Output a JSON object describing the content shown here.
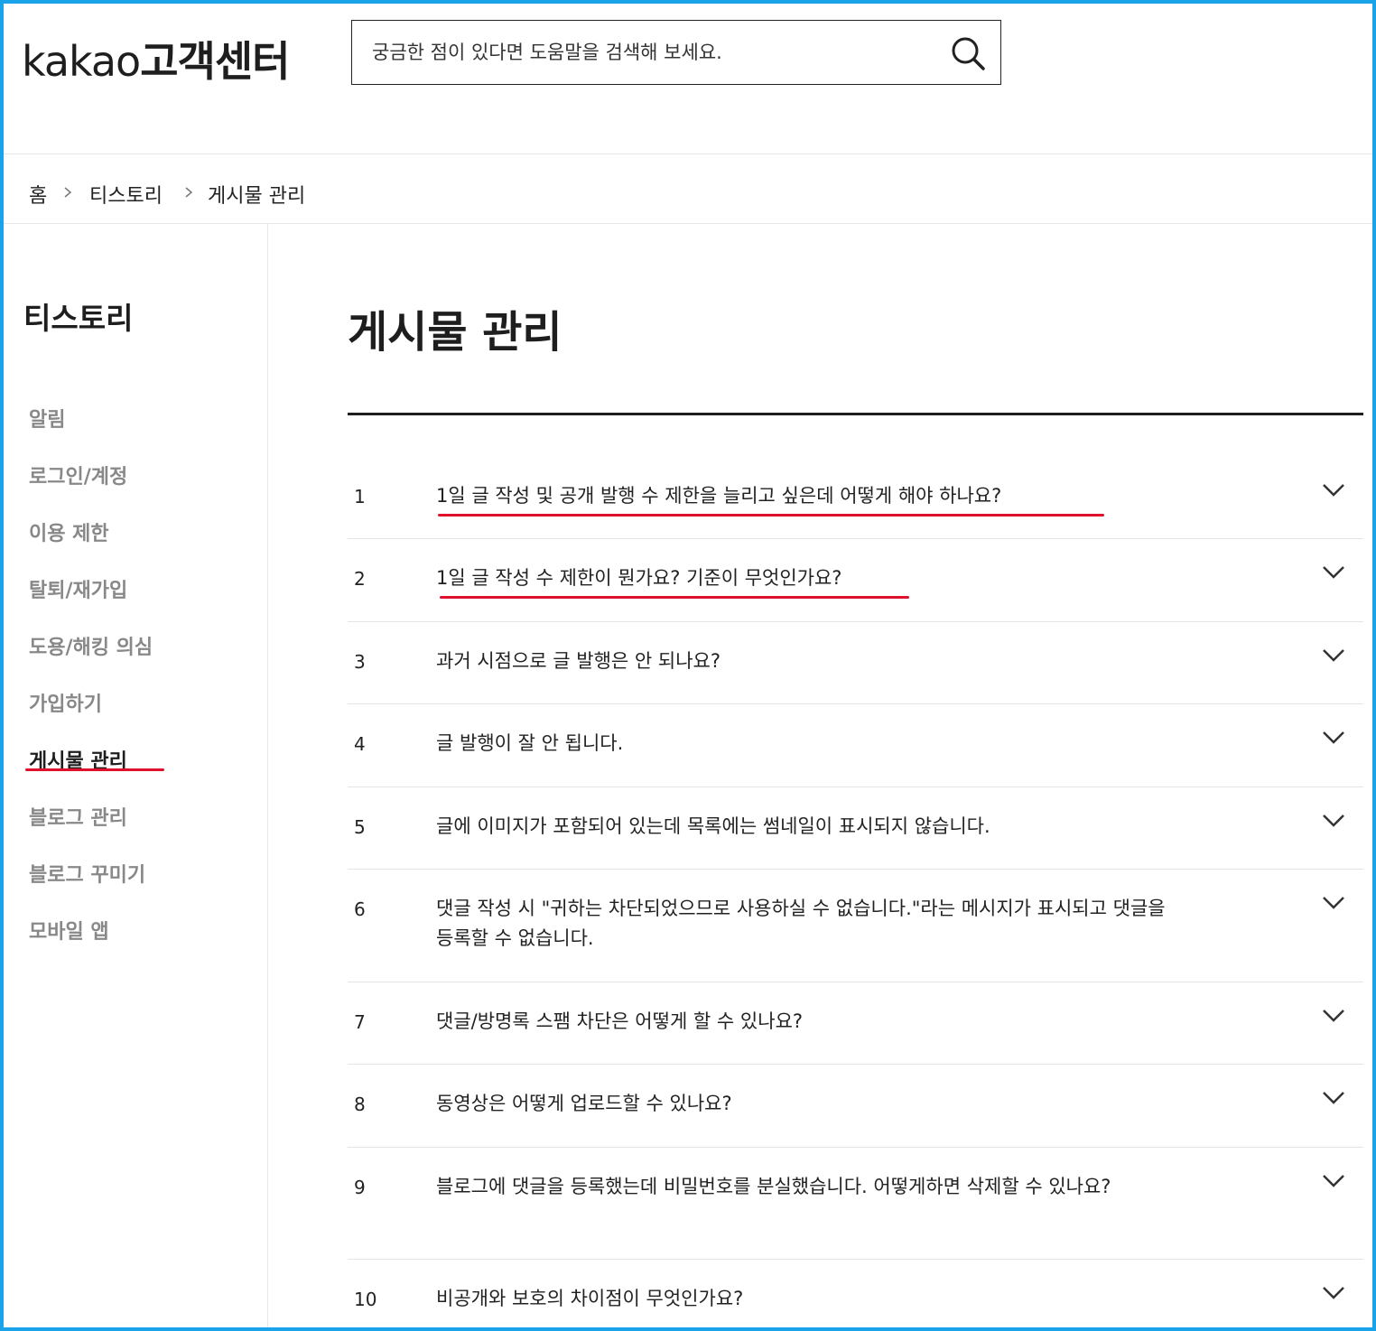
{
  "header": {
    "logo_brand": "kakao",
    "logo_text": "고객센터",
    "search_placeholder": "궁금한 점이 있다면 도움말을 검색해 보세요."
  },
  "breadcrumb": {
    "items": [
      "홈",
      "티스토리",
      "게시물 관리"
    ]
  },
  "sidebar": {
    "title": "티스토리",
    "items": [
      "알림",
      "로그인/계정",
      "이용 제한",
      "탈퇴/재가입",
      "도용/해킹 의심",
      "가입하기",
      "게시물 관리",
      "블로그 관리",
      "블로그 꾸미기",
      "모바일 앱"
    ],
    "active_item": "게시물 관리"
  },
  "main": {
    "title": "게시물 관리",
    "faqs": [
      {
        "num": "1",
        "question": "1일 글 작성 및 공개 발행 수 제한을 늘리고 싶은데 어떻게 해야 하나요?"
      },
      {
        "num": "2",
        "question": "1일 글 작성 수 제한이 뭔가요? 기준이 무엇인가요?"
      },
      {
        "num": "3",
        "question": "과거 시점으로 글 발행은 안 되나요?"
      },
      {
        "num": "4",
        "question": "글 발행이 잘 안 됩니다."
      },
      {
        "num": "5",
        "question": "글에 이미지가 포함되어 있는데 목록에는 썸네일이 표시되지 않습니다."
      },
      {
        "num": "6",
        "question": "댓글 작성 시 \"귀하는 차단되었으므로 사용하실 수 없습니다.\"라는 메시지가 표시되고 댓글을 등록할 수 없습니다."
      },
      {
        "num": "7",
        "question": "댓글/방명록 스팸 차단은 어떻게 할 수 있나요?"
      },
      {
        "num": "8",
        "question": "동영상은 어떻게 업로드할 수 있나요?"
      },
      {
        "num": "9",
        "question": "블로그에 댓글을 등록했는데 비밀번호를 분실했습니다. 어떻게하면 삭제할 수 있나요?"
      },
      {
        "num": "10",
        "question": "비공개와 보호의 차이점이 무엇인가요?"
      }
    ]
  },
  "colors": {
    "frame": "#1aa3e8",
    "annotation_underline": "#e0112b",
    "text": "#222222",
    "inactive_menu": "#888888"
  }
}
